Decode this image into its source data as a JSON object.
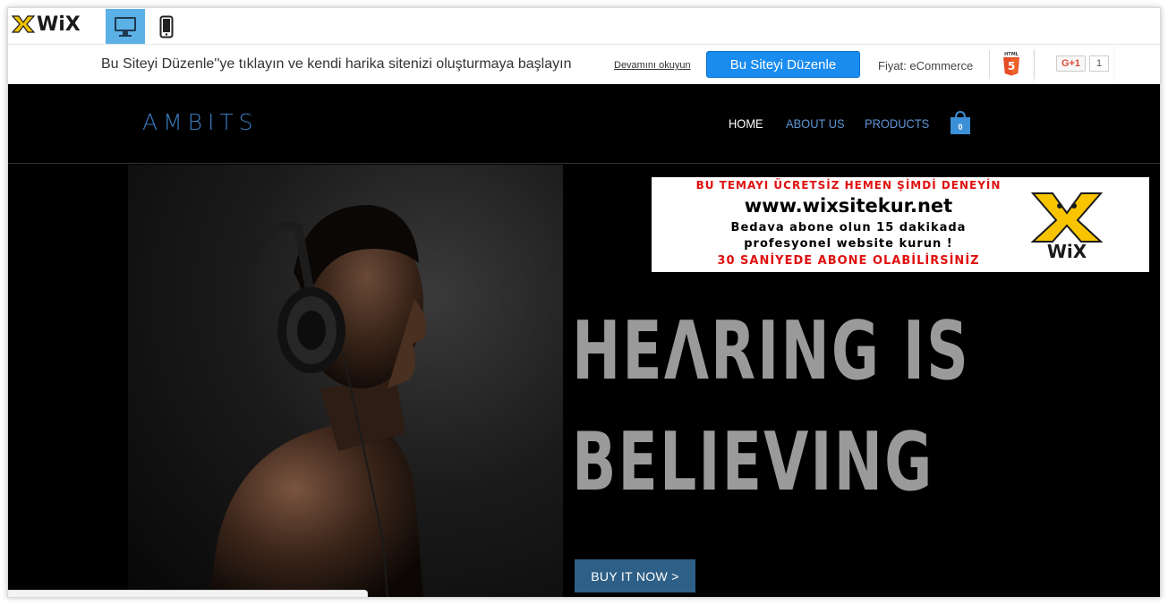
{
  "toolbar": {
    "logo_text": "WiX",
    "desktop_icon": "desktop-icon",
    "mobile_icon": "mobile-icon"
  },
  "promo": {
    "message": "Bu Siteyi Düzenle''ye tıklayın ve kendi harika sitenizi oluşturmaya başlayın",
    "read_more": "Devamını okuyun",
    "edit_button": "Bu Siteyi Düzenle",
    "price": "Fiyat: eCommerce",
    "html5_badge": "HTML",
    "gplus_label": "G+1",
    "gplus_count": "1"
  },
  "site": {
    "brand": "AMBITS",
    "nav": {
      "home": "HOME",
      "about": "ABOUT US",
      "products": "PRODUCTS"
    },
    "cart_count": "0",
    "hero_line1": "HEΛRING IS",
    "hero_line2": "BELIEVING",
    "buy_button": "BUY IT NOW >"
  },
  "ad": {
    "line1": "BU TEMAYI ÜCRETSİZ HEMEN ŞİMDİ DENEYİN",
    "line2": "www.wixsitekur.net",
    "line3": "Bedava abone olun 15 dakikada",
    "line4": "profesyonel website kurun !",
    "line5": "30 SANİYEDE ABONE OLABİLİRSİNİZ",
    "logo_text": "WiX"
  },
  "colors": {
    "accent_blue": "#1a8cf0",
    "desktop_active": "#5bb0e6",
    "nav_blue": "#5e95d3",
    "brand_blue": "#3a7bbf",
    "buy_button": "#2e5f86",
    "ad_red": "#e01010",
    "hero_text": "#9a9a9a"
  }
}
